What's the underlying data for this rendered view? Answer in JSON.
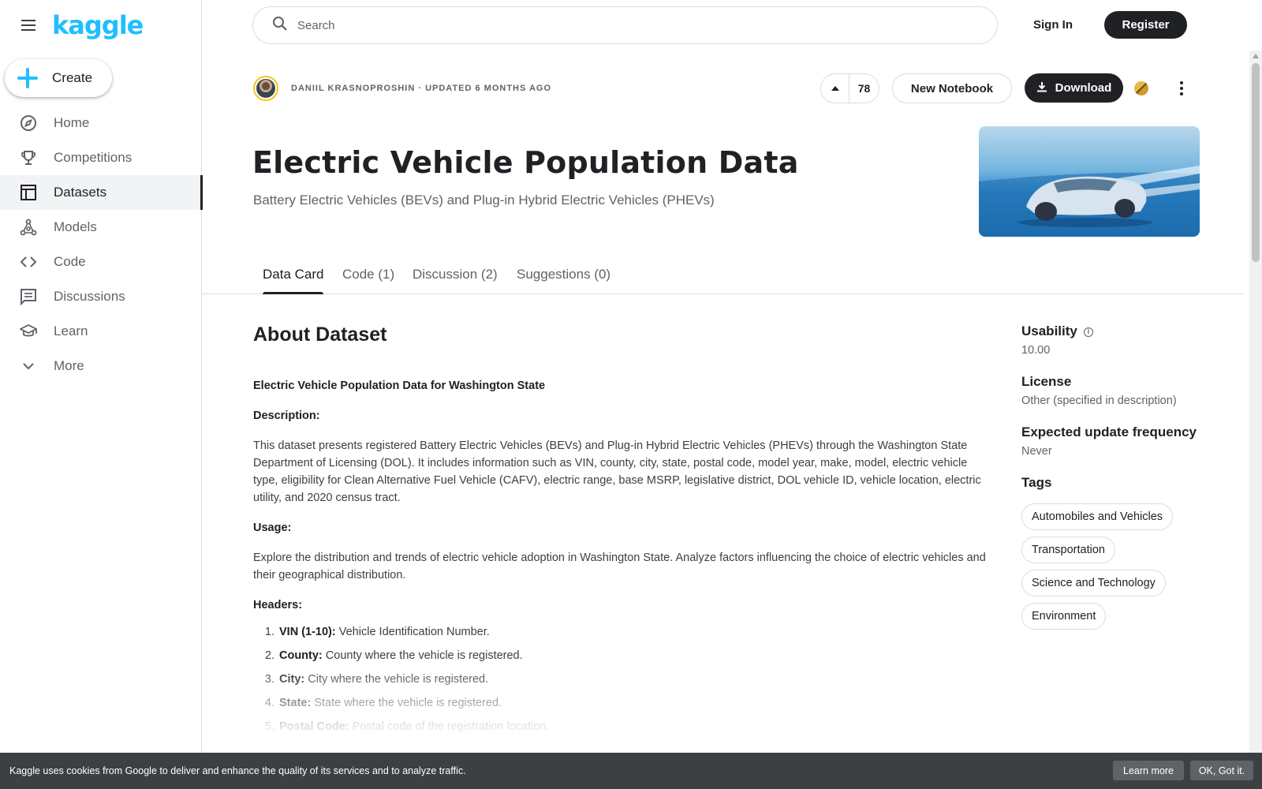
{
  "app": {
    "logo": "kaggle",
    "brand_color": "#20beff"
  },
  "sidebar": {
    "create_label": "Create",
    "items": [
      {
        "label": "Home",
        "icon": "compass-icon"
      },
      {
        "label": "Competitions",
        "icon": "trophy-icon"
      },
      {
        "label": "Datasets",
        "icon": "table-icon",
        "active": true
      },
      {
        "label": "Models",
        "icon": "models-icon"
      },
      {
        "label": "Code",
        "icon": "code-icon"
      },
      {
        "label": "Discussions",
        "icon": "comment-icon"
      },
      {
        "label": "Learn",
        "icon": "school-icon"
      },
      {
        "label": "More",
        "icon": "chevron-down-icon"
      }
    ]
  },
  "topbar": {
    "search_placeholder": "Search",
    "signin_label": "Sign In",
    "register_label": "Register"
  },
  "dataset": {
    "byline": "Daniil Krasnoproshin · Updated 6 months ago",
    "upvotes": "78",
    "new_notebook_label": "New Notebook",
    "download_label": "Download",
    "title": "Electric Vehicle Population Data",
    "subtitle": "Battery Electric Vehicles (BEVs) and Plug-in Hybrid Electric Vehicles (PHEVs)"
  },
  "tabs": [
    {
      "label": "Data Card",
      "active": true
    },
    {
      "label": "Code (1)"
    },
    {
      "label": "Discussion (2)"
    },
    {
      "label": "Suggestions (0)"
    }
  ],
  "about": {
    "heading": "About Dataset",
    "intro_title": "Electric Vehicle Population Data for Washington State",
    "description_label": "Description:",
    "description": "This dataset presents registered Battery Electric Vehicles (BEVs) and Plug-in Hybrid Electric Vehicles (PHEVs) through the Washington State Department of Licensing (DOL). It includes information such as VIN, county, city, state, postal code, model year, make, model, electric vehicle type, eligibility for Clean Alternative Fuel Vehicle (CAFV), electric range, base MSRP, legislative district, DOL vehicle ID, vehicle location, electric utility, and 2020 census tract.",
    "usage_label": "Usage:",
    "usage": "Explore the distribution and trends of electric vehicle adoption in Washington State. Analyze factors influencing the choice of electric vehicles and their geographical distribution.",
    "headers_label": "Headers:",
    "headers": [
      {
        "num": "1.",
        "name": "VIN (1-10):",
        "desc": "Vehicle Identification Number."
      },
      {
        "num": "2.",
        "name": "County:",
        "desc": "County where the vehicle is registered."
      },
      {
        "num": "3.",
        "name": "City:",
        "desc": "City where the vehicle is registered."
      },
      {
        "num": "4.",
        "name": "State:",
        "desc": "State where the vehicle is registered."
      },
      {
        "num": "5.",
        "name": "Postal Code:",
        "desc": "Postal code of the registration location."
      }
    ]
  },
  "meta": {
    "usability_label": "Usability",
    "usability_value": "10.00",
    "license_label": "License",
    "license_value": "Other (specified in description)",
    "frequency_label": "Expected update frequency",
    "frequency_value": "Never",
    "tags_label": "Tags",
    "tags": [
      "Automobiles and Vehicles",
      "Transportation",
      "Science and Technology",
      "Environment"
    ]
  },
  "cookie": {
    "text": "Kaggle uses cookies from Google to deliver and enhance the quality of its services and to analyze traffic.",
    "learn_more": "Learn more",
    "ok": "OK, Got it."
  }
}
